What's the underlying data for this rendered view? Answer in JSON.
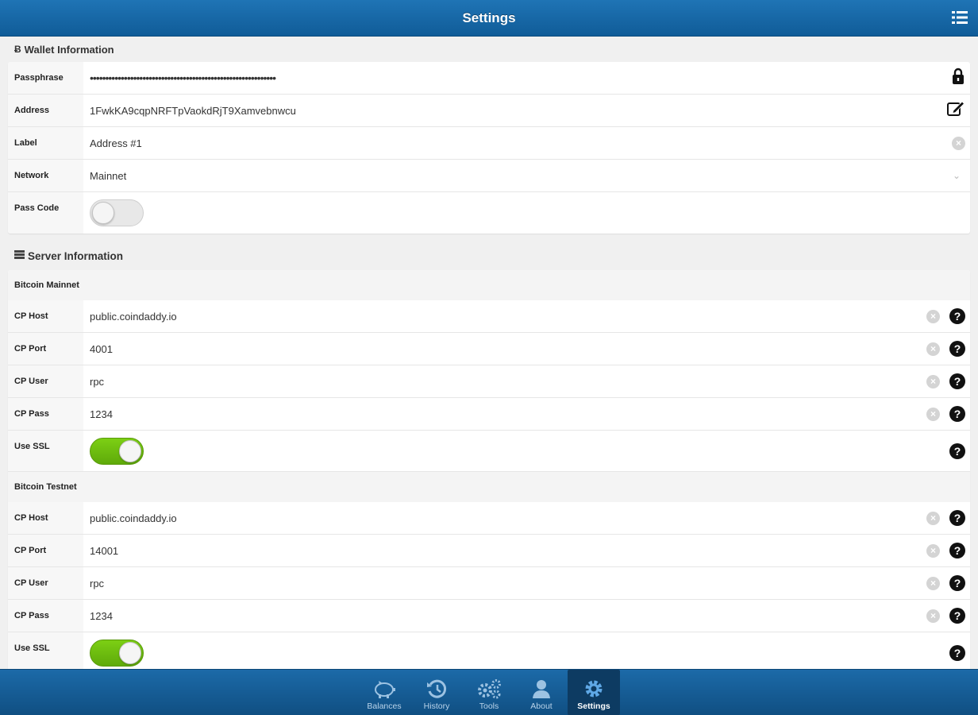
{
  "header": {
    "title": "Settings",
    "menu_icon": "list-icon"
  },
  "wallet": {
    "section_title": "Wallet Information",
    "section_icon": "bitcoin-icon",
    "rows": {
      "passphrase": {
        "label": "Passphrase",
        "value": "••••••••••••••••••••••••••••••••••••••••••••••••••••••••••••",
        "icon": "lock-icon"
      },
      "address": {
        "label": "Address",
        "value": "1FwkKA9cqpNRFTpVaokdRjT9Xamvebnwcu",
        "icon": "edit-icon"
      },
      "label": {
        "label": "Label",
        "value": "Address #1",
        "icon": "clear-icon"
      },
      "network": {
        "label": "Network",
        "value": "Mainnet",
        "icon": "chevron-down-icon"
      },
      "passcode": {
        "label": "Pass Code",
        "toggle": "off"
      }
    }
  },
  "server": {
    "section_title": "Server Information",
    "section_icon": "server-list-icon",
    "groups": [
      {
        "title": "Bitcoin Mainnet",
        "host_label": "CP Host",
        "host": "public.coindaddy.io",
        "port_label": "CP Port",
        "port": "4001",
        "user_label": "CP User",
        "user": "rpc",
        "pass_label": "CP Pass",
        "pass": "1234",
        "ssl_label": "Use SSL",
        "ssl": "on"
      },
      {
        "title": "Bitcoin Testnet",
        "host_label": "CP Host",
        "host": "public.coindaddy.io",
        "port_label": "CP Port",
        "port": "14001",
        "user_label": "CP User",
        "user": "rpc",
        "pass_label": "CP Pass",
        "pass": "1234",
        "ssl_label": "Use SSL",
        "ssl": "on"
      }
    ]
  },
  "tabbar": {
    "tabs": [
      {
        "label": "Balances",
        "icon": "piggy-bank-icon"
      },
      {
        "label": "History",
        "icon": "history-icon"
      },
      {
        "label": "Tools",
        "icon": "cogs-icon"
      },
      {
        "label": "About",
        "icon": "user-icon"
      },
      {
        "label": "Settings",
        "icon": "gear-icon",
        "active": true
      }
    ]
  },
  "colors": {
    "header": "#105c98",
    "toggle_on": "#6abf10",
    "tab_active": "#0d3b62"
  }
}
